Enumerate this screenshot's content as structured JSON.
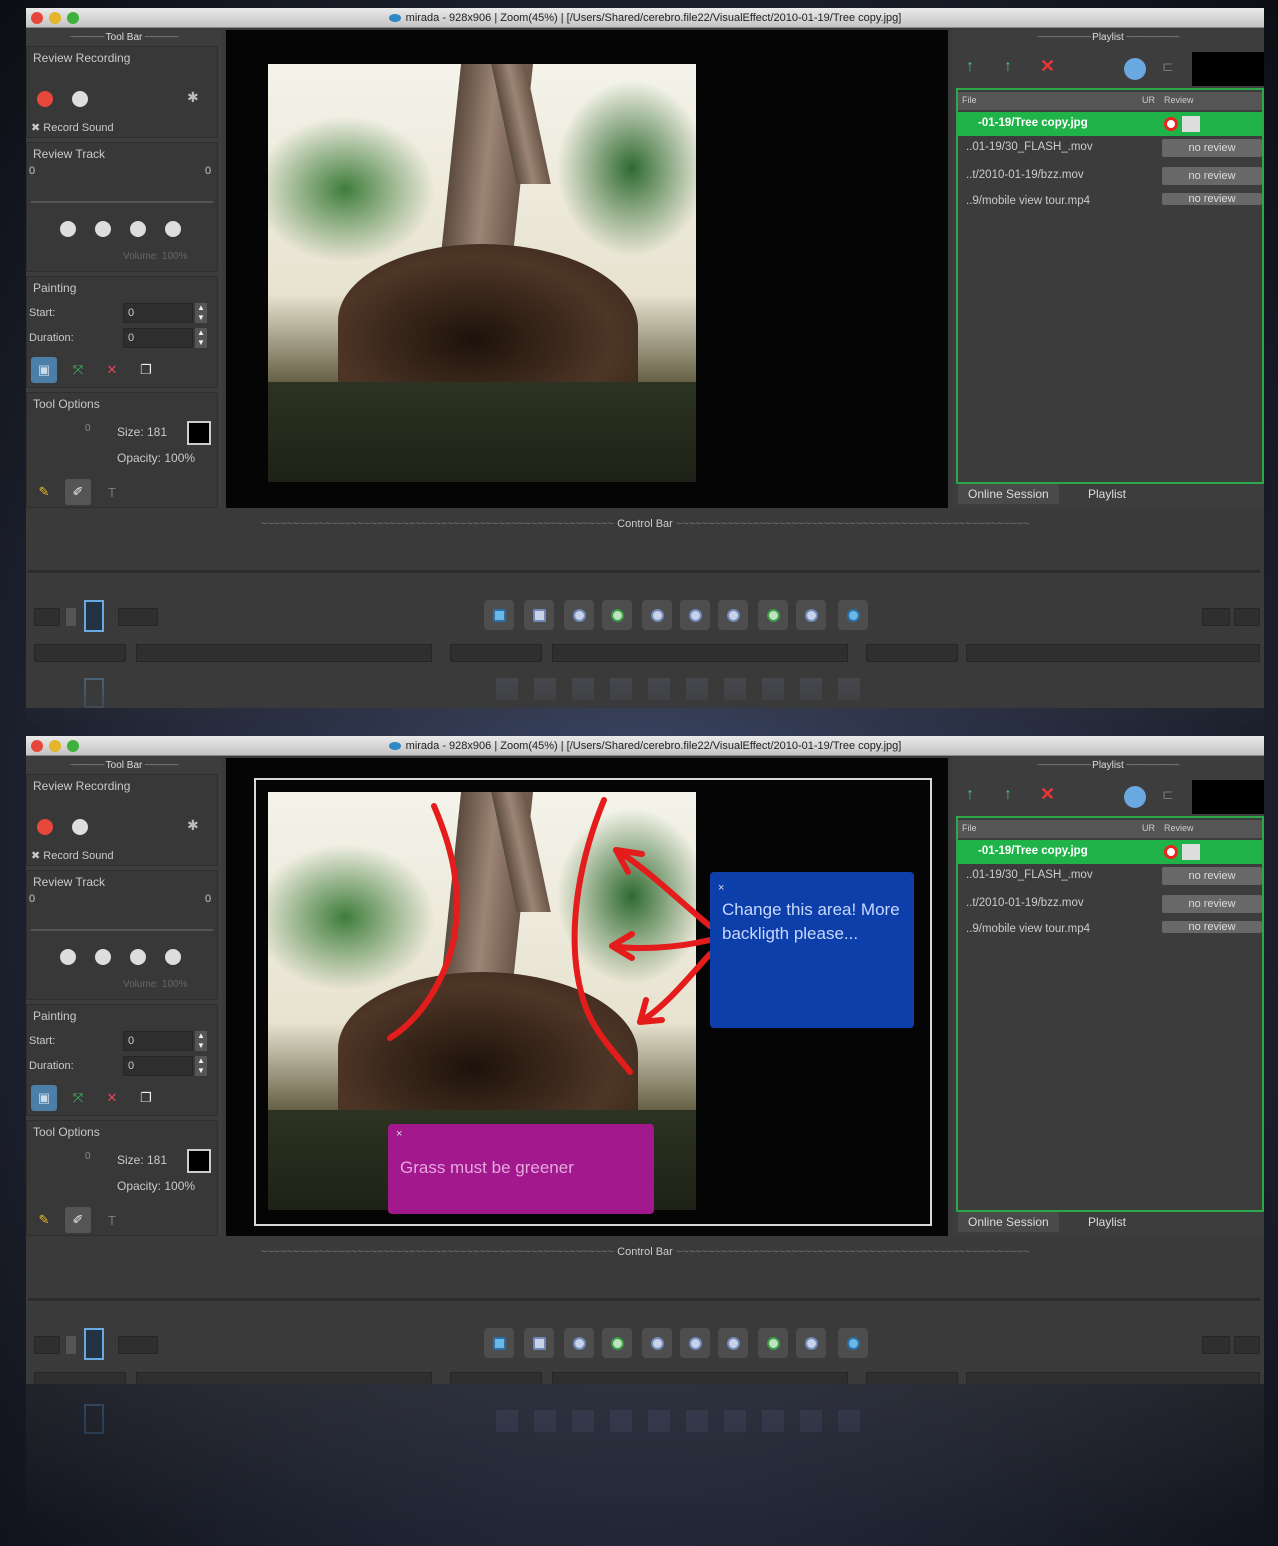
{
  "window": {
    "title": "mirada - 928x906 | Zoom(45%) | [/Users/Shared/cerebro.file22/VisualEffect/2010-01-19/Tree copy.jpg]"
  },
  "toolbar": {
    "header": "Tool Bar",
    "review_recording_label": "Review Recording",
    "record_sound_label": "Record Sound",
    "review_track_label": "Review Track",
    "track_start": "0",
    "track_end": "0",
    "volume_label": "Volume: 100%",
    "painting_label": "Painting",
    "start_label": "Start:",
    "start_value": "0",
    "duration_label": "Duration:",
    "duration_value": "0",
    "tool_options_label": "Tool Options",
    "size_label": "Size: 181",
    "opacity_label": "Opacity: 100%",
    "slider_value": "0",
    "text_tool_glyph": "T"
  },
  "playlist": {
    "header": "Playlist",
    "col_file": "File",
    "col_ur": "UR",
    "col_review": "Review",
    "rows": [
      {
        "file": "-01-19/Tree copy.jpg",
        "review": ""
      },
      {
        "file": "..01-19/30_FLASH_.mov",
        "review": "no review"
      },
      {
        "file": "..t/2010-01-19/bzz.mov",
        "review": "no review"
      },
      {
        "file": "..9/mobile view tour.mp4",
        "review": "no review"
      }
    ],
    "tab_online": "Online Session",
    "tab_playlist": "Playlist"
  },
  "control_bar": {
    "header": "Control Bar"
  },
  "annotations": {
    "blue_note": "Change this area! More backligth please...",
    "magenta_note": "Grass must be greener",
    "close_glyph": "×"
  },
  "colors": {
    "accent_green": "#1fb34a",
    "note_blue": "#0c3faa",
    "note_magenta": "#a2198e",
    "stroke_red": "#e41c1c"
  }
}
